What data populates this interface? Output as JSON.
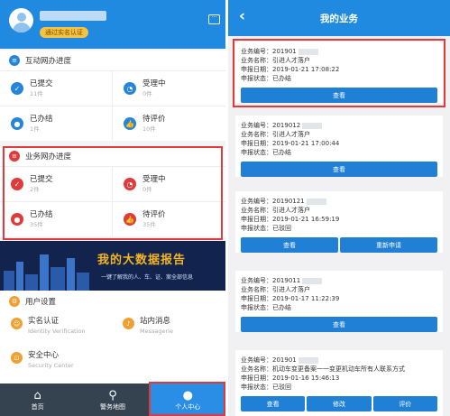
{
  "left": {
    "header": {
      "badge": "通过实名认证"
    },
    "sections": [
      {
        "title": "互动网办进度",
        "items": [
          {
            "label": "已提交",
            "value": "11件"
          },
          {
            "label": "受理中",
            "value": "0件"
          },
          {
            "label": "已办结",
            "value": "1件"
          },
          {
            "label": "待评价",
            "value": "10件"
          }
        ]
      },
      {
        "title": "业务网办进度",
        "items": [
          {
            "label": "已提交",
            "value": "2件"
          },
          {
            "label": "受理中",
            "value": "0件"
          },
          {
            "label": "已办结",
            "value": "35件"
          },
          {
            "label": "待评价",
            "value": "35件"
          }
        ]
      }
    ],
    "banner": {
      "title": "我的大数据报告",
      "subtitle": "一键了解我的人、车、证、案全部信息"
    },
    "user_settings": {
      "title": "用户设置",
      "items": [
        {
          "label": "实名认证",
          "sub": "Identity Verification"
        },
        {
          "label": "站内消息",
          "sub": "Messagerie"
        },
        {
          "label": "安全中心",
          "sub": "Security Center"
        }
      ]
    },
    "tabbar": [
      {
        "label": "首页"
      },
      {
        "label": "警务地图"
      },
      {
        "label": "个人中心"
      }
    ]
  },
  "right": {
    "title": "我的业务",
    "field_labels": {
      "no": "业务编号：",
      "name": "业务名称：",
      "date": "申报日期：",
      "status": "申报状态："
    },
    "cards": [
      {
        "no": "201901",
        "name": "引进人才落户",
        "date": "2019-01-21 17:08:22",
        "status": "已办结",
        "buttons": [
          "查看"
        ]
      },
      {
        "no": "2019012",
        "name": "引进人才落户",
        "date": "2019-01-21 17:00:44",
        "status": "已办结",
        "buttons": [
          "查看"
        ]
      },
      {
        "no": "20190121",
        "name": "引进人才落户",
        "date": "2019-01-21 16:59:19",
        "status": "已驳回",
        "buttons": [
          "查看",
          "重新申请"
        ]
      },
      {
        "no": "2019011",
        "name": "引进人才落户",
        "date": "2019-01-17 11:22:39",
        "status": "已办结",
        "buttons": [
          "查看"
        ]
      },
      {
        "no": "201901",
        "name": "机动车变更备案一一变更机动车所有人联系方式",
        "date": "2019-01-16 15:46:13",
        "status": "已驳回",
        "buttons": [
          "查看",
          "修改",
          "评价"
        ]
      }
    ]
  }
}
